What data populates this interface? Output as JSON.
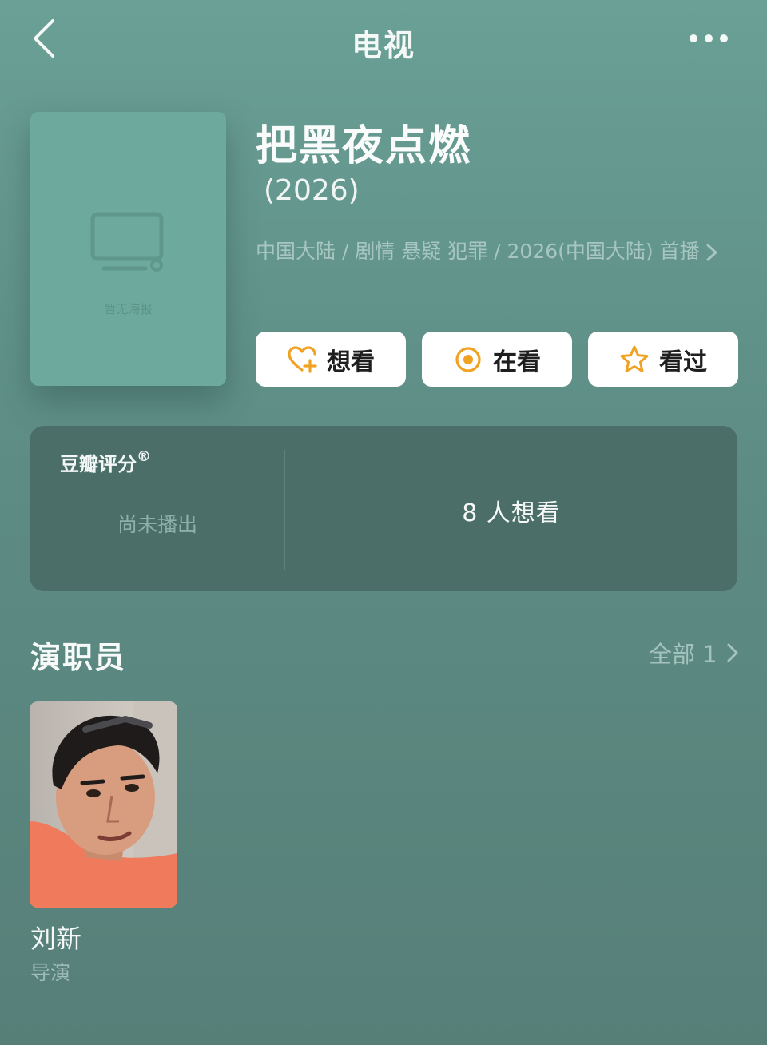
{
  "nav": {
    "title": "电视",
    "back_icon": "back-arrow-icon",
    "more_icon": "more-dots-icon"
  },
  "poster": {
    "placeholder_text": "暂无海报",
    "icon": "tv-icon"
  },
  "show": {
    "title": "把黑夜点燃",
    "year": "(2026)",
    "meta": "中国大陆 / 剧情 悬疑 犯罪 / 2026(中国大陆) 首播"
  },
  "actions": {
    "want_label": "想看",
    "want_icon": "heart-plus-icon",
    "watching_label": "在看",
    "watching_icon": "target-icon",
    "watched_label": "看过",
    "watched_icon": "star-icon",
    "accent": "#f0a323"
  },
  "rating": {
    "label": "豆瓣评分",
    "reg_mark": "®",
    "status": "尚未播出",
    "want_count": "8 人想看"
  },
  "cast": {
    "section_title": "演职员",
    "all_label": "全部 1",
    "members": [
      {
        "name": "刘新",
        "role": "导演"
      }
    ]
  },
  "colors": {
    "background": "#5d8c84",
    "card": "#4b6f68",
    "poster": "#6ea99d"
  }
}
